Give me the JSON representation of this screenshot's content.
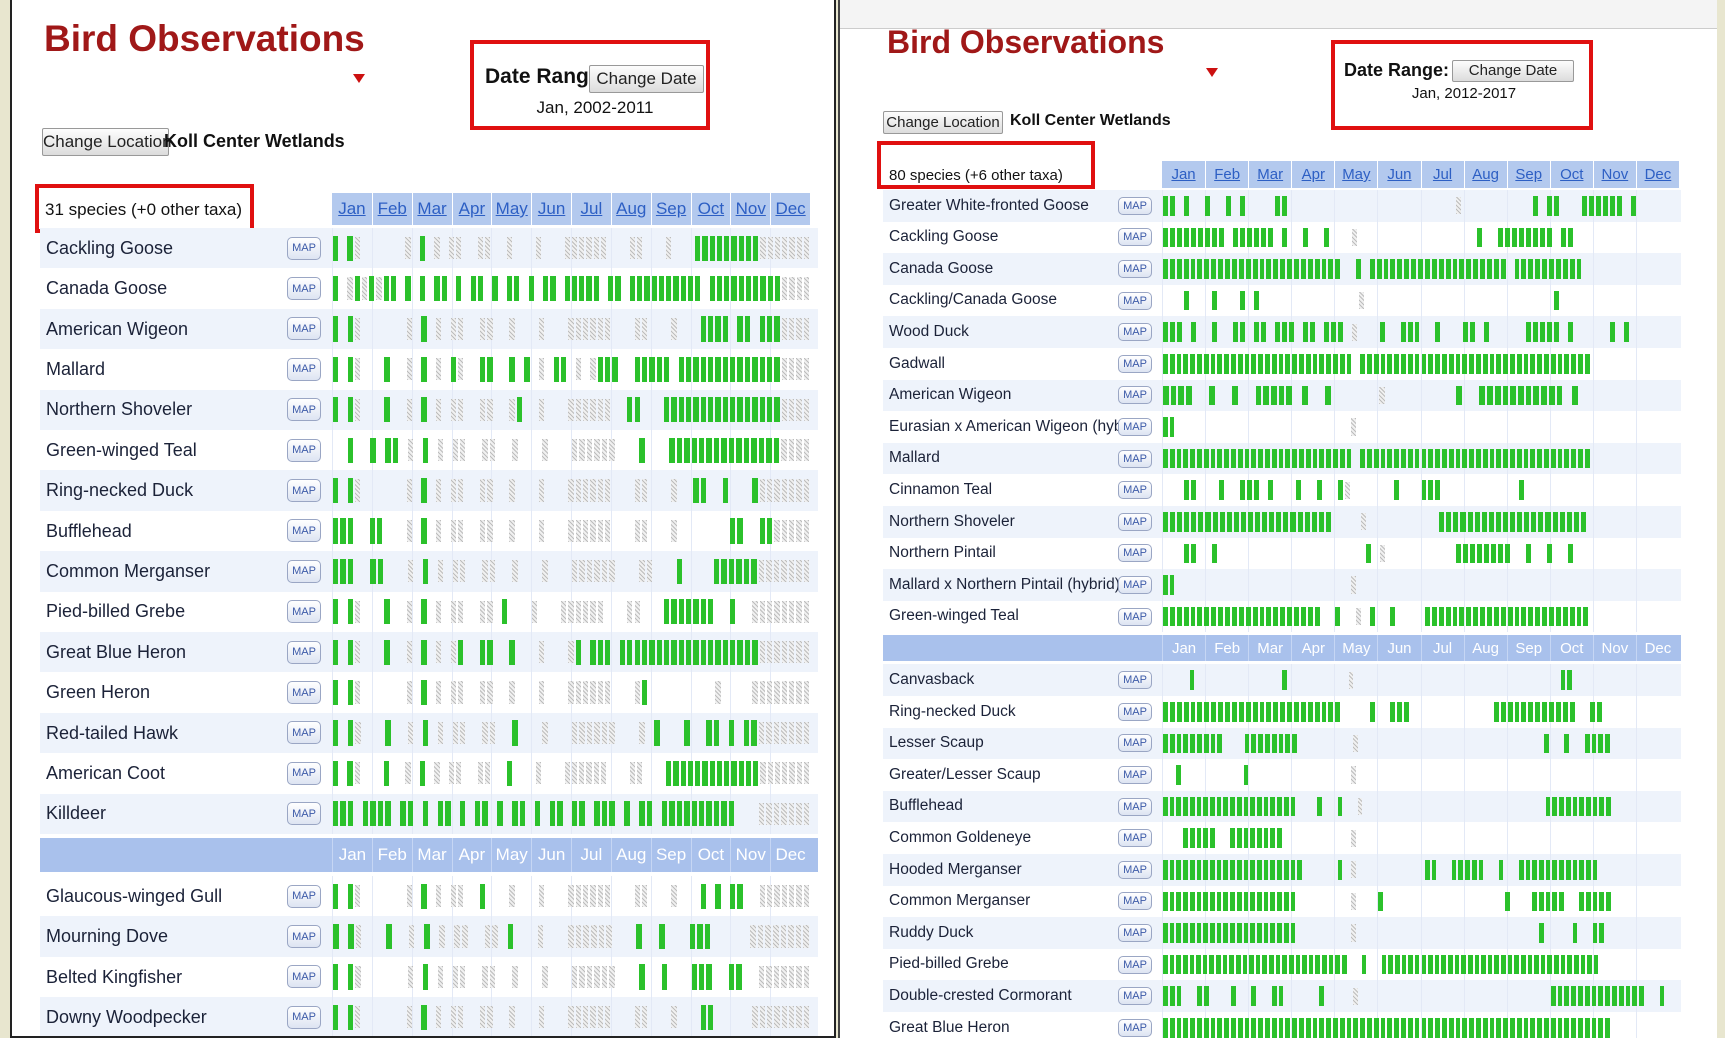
{
  "left": {
    "title": "Bird Observations",
    "date_range": {
      "label": "Date Range:",
      "button": "Change Date",
      "value": "Jan, 2002-2011"
    },
    "location": {
      "button": "Change Location",
      "name": "Koll Center Wetlands"
    },
    "species_count": "31 species (+0 other taxa)",
    "map_label": "MAP",
    "months": [
      "Jan",
      "Feb",
      "Mar",
      "Apr",
      "May",
      "Jun",
      "Jul",
      "Aug",
      "Sep",
      "Oct",
      "Nov",
      "Dec"
    ],
    "species": [
      {
        "name": "Cackling Goose",
        "obs": "g.gn......n.g.n.nn..nn..n...n...nnnnnn...nn...n...gggggggggnnnnnnn"
      },
      {
        "name": "Canada Goose",
        "obs": "g.ngngngg.g.g.gg.g.gg.g.gg.g.gg.ggggg.gg.gggggggggg.ggggggggggnnnn"
      },
      {
        "name": "American Wigeon",
        "obs": "g.gn......n.g.n.nn..nn..n...n...nnnnnn...nn...n...gggg.gg.gggnnnn"
      },
      {
        "name": "Mallard",
        "obs": "g.gn...g..n.g.n.gn..gg..g.g.n.gg.n.nggg..ggggg.ggggggggggggggnnnn"
      },
      {
        "name": "Northern Shoveler",
        "obs": "g.gn...g..n.g.n.nn..nn..ng..n...nnnnnn..gg...ggggggggggggggggnnnn"
      },
      {
        "name": "Green-winged Teal",
        "obs": "..g..g.gg.n.g.n.nn..nn..n...n...nnnnnn...g...gggggggggggggggnnnn"
      },
      {
        "name": "Ring-necked Duck",
        "obs": "g.gn......n.g.n.nn..nn..n...n...nnnnnn...nn...n..gg..g...gnnnnnnn"
      },
      {
        "name": "Bufflehead",
        "obs": "ggg..gg...n.g.n.nn..nn..n...n...nnnnnn...nn...n.......gg..ggnnnnn"
      },
      {
        "name": "Common Merganser",
        "obs": "ggg..gg...n.g.n.nn..nn..n...n...nnnnnn...nn...g....ggggggnnnnnnn"
      },
      {
        "name": "Pied-billed Grebe",
        "obs": "g.gn...g..n.g.n.nn..nn.g...n...nnnnnn...nn...ggggggg..g..nnnnnnnn"
      },
      {
        "name": "Great Blue Heron",
        "obs": "g.gn...g..n.g.n.ng..gg..g...n...ng.ggg.gggggggggggggggggggnnnnnnn"
      },
      {
        "name": "Green Heron",
        "obs": "g.gn......n.g.n.nn..nn..n...n...nnnnnn...ng.........n....nnnnnnnn"
      },
      {
        "name": "Red-tailed Hawk",
        "obs": "g.gn...g..n.g.n.nn..nn..g...n...nnnnnn...n.g...g..gg.g.ggnnnnnnn"
      },
      {
        "name": "American Coot",
        "obs": "g.gn...g..n.g.n.nn..nn..g...n...nnnnnn...nn...gggggggggggggnnnnnnn"
      },
      {
        "name": "Killdeer",
        "obs": "ggg.gggg.gg.g.gg.g.gg.g.gg.g.gg.gg.ggg.g.gg.gggggggggg...nnnnnnn"
      },
      {
        "name": "Glaucous-winged Gull",
        "obs": "g.gn......n.g.n.nn..g...n...n...nnnnnn...nn...n...g.g.gg..nnnnnnn"
      },
      {
        "name": "Mourning Dove",
        "obs": "g.gn...g..n.g.n.nn..nn.g...n...nnnnnn...g..g...ggg.....nnnnnnnn"
      },
      {
        "name": "Belted Kingfisher",
        "obs": "g.gn......n.g.n.nn..nn..n...n...nnnnnn...g..g...ggg..gg..nnnnnnn"
      },
      {
        "name": "Downy Woodpecker",
        "obs": "g.gn......n.g.n.nn..nn..n...n...nnnnnn...nn...n...gg.....nnnnnnnn"
      }
    ]
  },
  "right": {
    "title": "Bird Observations",
    "date_range": {
      "label": "Date Range:",
      "button": "Change Date",
      "value": "Jan, 2012-2017"
    },
    "location": {
      "button": "Change Location",
      "name": "Koll Center Wetlands"
    },
    "species_count": "80 species (+6 other taxa)",
    "map_label": "MAP",
    "months": [
      "Jan",
      "Feb",
      "Mar",
      "Apr",
      "May",
      "Jun",
      "Jul",
      "Aug",
      "Sep",
      "Oct",
      "Nov",
      "Dec"
    ],
    "species": [
      {
        "name": "Greater White-fronted Goose",
        "obs": "gg.g..g..g.g....gg........................n..........g.gg...gggggg.g......"
      },
      {
        "name": "Cackling Goose",
        "obs": "ggggggggg.gggggg.g..g..g...n.................g..gggggggg.gg..............."
      },
      {
        "name": "Canada Goose",
        "obs": "gggggggggggggggggggggggggg..g.gggggggggggggggggggg.gggggggggg.............."
      },
      {
        "name": "Cackling/Canada Goose",
        "obs": "...g...g...g.g..............n...........................g................."
      },
      {
        "name": "Wood Duck",
        "obs": "ggg.g..g..gg.gg.ggg.gg.ggg.n...g..ggg..g...gg.g.....ggggg.g.....g.g......."
      },
      {
        "name": "Gadwall",
        "obs": "gggggggggggggggggggggggggggg.gggggggggggggggggggggggggggggggggg............."
      },
      {
        "name": "American Wigeon",
        "obs": "gggg..g..g..ggggg.g..g......n.........g..ggggggggggg.g............."
      },
      {
        "name": "Eurasian x American Wigeon (hybrid)",
        "obs": "gg..........................n................................................"
      },
      {
        "name": "Mallard",
        "obs": "gggggggggggggggggggggggggggg.gggggggggggggggggggggggggggggggggg............."
      },
      {
        "name": "Cinnamon Teal",
        "obs": "...gg...g..ggg.g...g..g..gn......g...ggg...........g......................"
      },
      {
        "name": "Northern Shoveler",
        "obs": "gggggggggggggggggggggggg....n..........ggggggggggggggggggggg............."
      },
      {
        "name": "Northern Pintail",
        "obs": "...gg..g.....................g.n..........gggggggg..g..g..g..............."
      },
      {
        "name": "Mallard x Northern Pintail (hybrid)",
        "obs": "gg..........................n................................................"
      },
      {
        "name": "Green-winged Teal",
        "obs": "ggggggggggggggggggggggg..g..n.g..g....gggggggggggggggggggggggg............."
      },
      {
        "name": "Canvasback",
        "obs": "....g.............g.........n...............................gg................"
      },
      {
        "name": "Ring-necked Duck",
        "obs": "gggggggggggggggggggggggggg....g..ggg............gggggggggggg..gg..........."
      },
      {
        "name": "Lesser Scaup",
        "obs": "ggggggggg...gggggggg........n...........................g..g..gggg.........."
      },
      {
        "name": "Greater/Lesser Scaup",
        "obs": "..g.........g...............n................................................"
      },
      {
        "name": "Bufflehead",
        "obs": "gggggggggggggggggggg...g..g..n...........................gggggggggg.........."
      },
      {
        "name": "Common Goldeneye",
        "obs": "...ggggg..gggggggg..........n................................................"
      },
      {
        "name": "Hooded Merganser",
        "obs": "ggggggggggggggggggggg.....g.n..........gg..ggggg..g..gggggggggggg............"
      },
      {
        "name": "Common Merganser",
        "obs": "gggggggggggggggggggg........n...g..................g...ggggg..ggggg.........."
      },
      {
        "name": "Ruddy Duck",
        "obs": "gggggggggggggggggggg........n...........................g....g..gg..........."
      },
      {
        "name": "Pied-billed Grebe",
        "obs": "gggggggggggggggggggggggggggg..g..ggggggggggggggggggggggggggggggggg............"
      },
      {
        "name": "Double-crested Cormorant",
        "obs": "ggg..gg...g..g..gg.....g....n............................gggggggggggggg..g.."
      },
      {
        "name": "Great Blue Heron",
        "obs": "gggggggggggggggggggggggggggggggggggggggggggggggggggggggggggggggggg.........."
      }
    ]
  }
}
